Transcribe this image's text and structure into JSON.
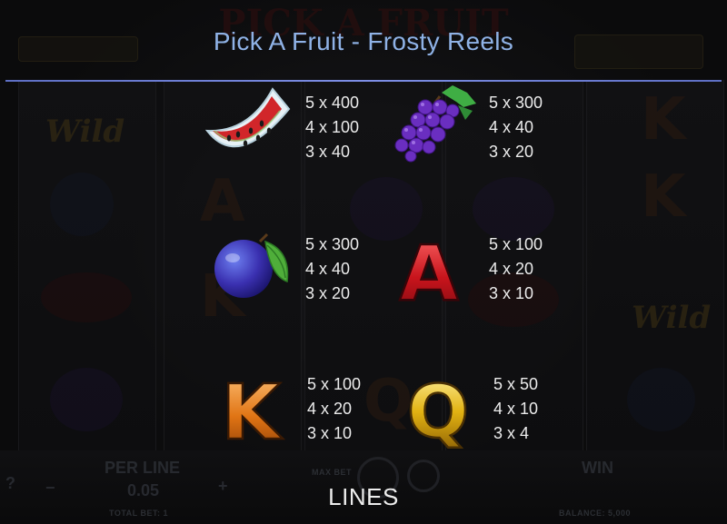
{
  "background": {
    "logo_text": "PICK A FRUIT",
    "per_line_label": "PER LINE",
    "per_line_value": "0.05",
    "win_label": "WIN",
    "max_bet_label": "MAX BET",
    "total_bet_label": "TOTAL BET: 1",
    "balance_label": "BALANCE: 5,000",
    "help_label": "?"
  },
  "header": {
    "title": "Pick A Fruit - Frosty Reels"
  },
  "paytable": [
    {
      "symbol": "watermelon-icon",
      "pays": [
        "5 x 400",
        "4 x 100",
        "3 x 40"
      ]
    },
    {
      "symbol": "grapes-icon",
      "pays": [
        "5 x 300",
        "4 x 40",
        "3 x 20"
      ]
    },
    {
      "symbol": "plum-icon",
      "pays": [
        "5 x 300",
        "4 x 40",
        "3 x 20"
      ]
    },
    {
      "symbol": "letter-a-icon",
      "letter": "A",
      "pays": [
        "5 x 100",
        "4 x 20",
        "3 x 10"
      ]
    },
    {
      "symbol": "letter-k-icon",
      "letter": "K",
      "pays": [
        "5 x 100",
        "4 x 20",
        "3 x 10"
      ]
    },
    {
      "symbol": "letter-q-icon",
      "letter": "Q",
      "pays": [
        "5 x 50",
        "4 x 10",
        "3 x 4"
      ]
    }
  ],
  "footer": {
    "section_label": "LINES"
  },
  "colors": {
    "title": "#8fb2e6",
    "rule": "#6f80d8",
    "pay_text": "#ececec"
  }
}
